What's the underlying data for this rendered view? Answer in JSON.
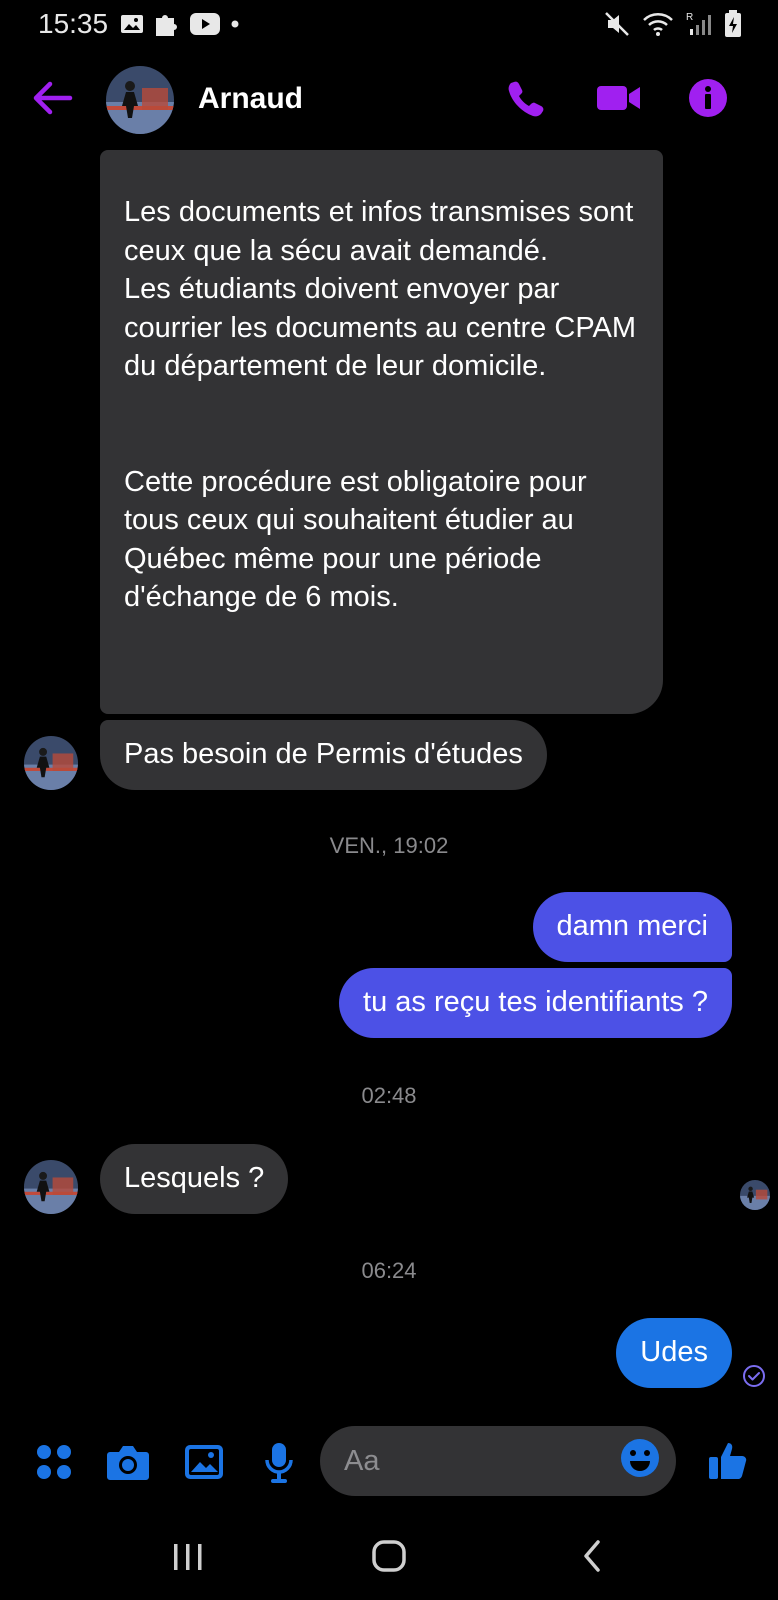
{
  "status_bar": {
    "time": "15:35"
  },
  "header": {
    "contact_name": "Arnaud"
  },
  "messages": {
    "long_text": "Les documents et infos transmises sont ceux que la sécu avait demandé.\nLes étudiants doivent envoyer par courrier les documents au centre CPAM du département de leur domicile.\n\n\nCette procédure est obligatoire pour tous ceux qui souhaitent étudier au Québec même pour une période d'échange de 6 mois.",
    "permis": "Pas besoin de Permis d'études",
    "ts1": "VEN., 19:02",
    "damn": "damn merci",
    "tu_as": "tu as reçu tes identifiants ?",
    "ts2": "02:48",
    "lesquels": "Lesquels ?",
    "ts3": "06:24",
    "udes": "Udes"
  },
  "composer": {
    "placeholder": "Aa"
  },
  "colors": {
    "accent_purple": "#a020f0",
    "outgoing_bubble": "#4c51e6",
    "outgoing_bubble_last": "#1b74e4",
    "incoming_bubble": "#333335",
    "composer_icons": "#1b74e4"
  }
}
